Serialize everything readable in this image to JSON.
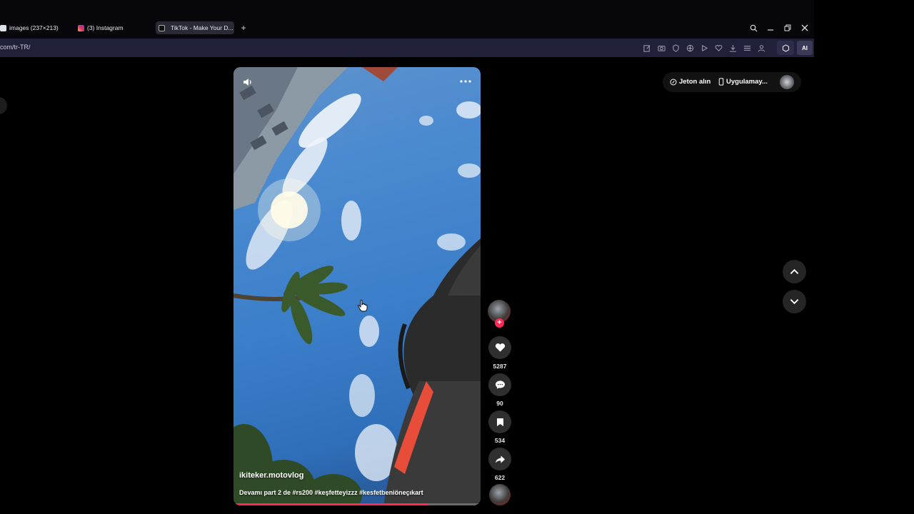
{
  "browser": {
    "tabs": [
      {
        "label": "images (237×213)",
        "icon": "document-icon"
      },
      {
        "label": "(3) Instagram",
        "icon": "instagram-icon"
      },
      {
        "label": "TikTok - Make Your D...",
        "icon": "tiktok-icon",
        "active": true
      }
    ],
    "url": "com/tr-TR/",
    "ai_label": "AI"
  },
  "header": {
    "coins_label": "Jeton alın",
    "get_app_label": "Uygulamay..."
  },
  "video": {
    "author": "ikiteker.motovlog",
    "caption": "Devamı part 2 de #rs200 #keşfetteyizzz #kesfetbeniöneçıkart",
    "progress_fraction": 0.79
  },
  "actions": {
    "likes": "5287",
    "comments": "90",
    "saves": "534",
    "shares": "622"
  },
  "colors": {
    "accent": "#fe2c55",
    "background": "#000000",
    "address_bar": "#20203a"
  }
}
